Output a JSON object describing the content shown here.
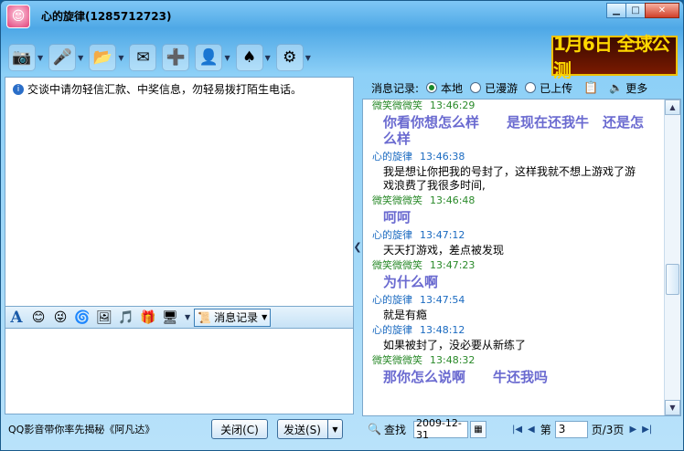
{
  "window": {
    "title": "心的旋律(1285712723)",
    "min": "▁",
    "max": "□",
    "close": "✕"
  },
  "ad": {
    "text": "1月6日 全球公测"
  },
  "notice": {
    "text": "交谈中请勿轻信汇款、中奖信息，勿轻易拨打陌生电话。"
  },
  "format": {
    "msg_record": "消息记录"
  },
  "bottom": {
    "promo": "QQ影音带你率先揭秘《阿凡达》",
    "close": "关闭(C)",
    "send": "发送(S)"
  },
  "history": {
    "label": "消息记录:",
    "opt_local": "本地",
    "opt_roam": "已漫游",
    "opt_upload": "已上传",
    "more": "更多",
    "messages": [
      {
        "sender": "微笑微微笑",
        "time": "13:46:29",
        "text": "你看你想怎么样　　是现在还我牛　还是怎么样",
        "big": true
      },
      {
        "sender": "心的旋律",
        "time": "13:46:38",
        "text": "我是想让你把我的号封了，这样我就不想上游戏了游戏浪费了我很多时间,",
        "big": false
      },
      {
        "sender": "微笑微微笑",
        "time": "13:46:48",
        "text": "呵呵",
        "big": true
      },
      {
        "sender": "心的旋律",
        "time": "13:47:12",
        "text": "天天打游戏，差点被发现",
        "big": false
      },
      {
        "sender": "微笑微微笑",
        "time": "13:47:23",
        "text": "为什么啊",
        "big": true
      },
      {
        "sender": "心的旋律",
        "time": "13:47:54",
        "text": "就是有瘾",
        "big": false
      },
      {
        "sender": "心的旋律",
        "time": "13:48:12",
        "text": "如果被封了，没必要从新练了",
        "big": false
      },
      {
        "sender": "微笑微微笑",
        "time": "13:48:32",
        "text": "那你怎么说啊　　牛还我吗",
        "big": true
      }
    ],
    "search": "查找",
    "date": "2009-12-31",
    "page_prefix": "第",
    "page": "3",
    "page_suffix": "页/3页"
  }
}
